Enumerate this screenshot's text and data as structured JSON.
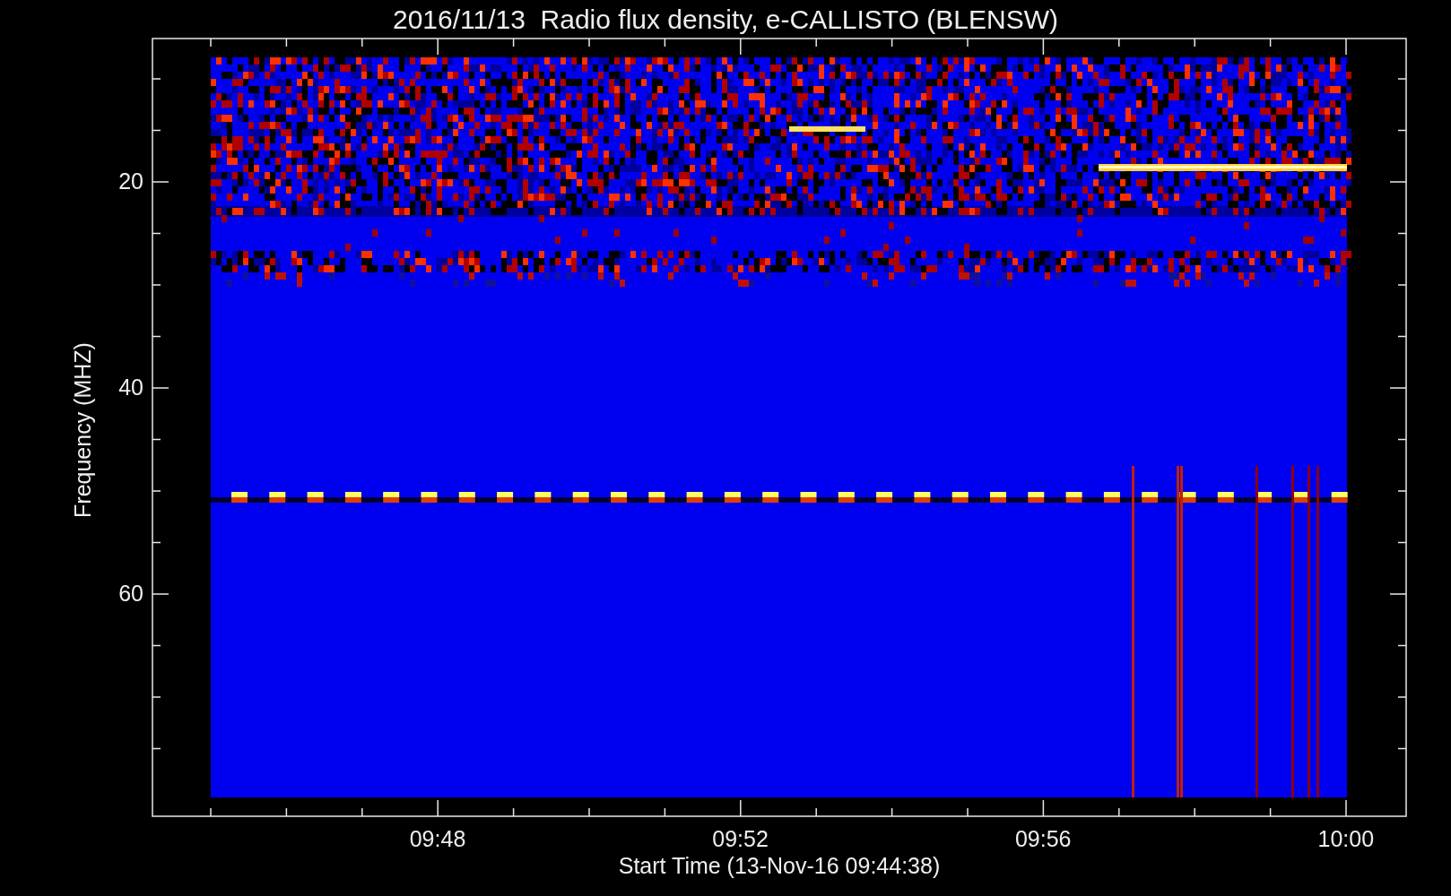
{
  "plot": {
    "title": "2016/11/13  Radio flux density, e-CALLISTO (BLENSW)",
    "ylabel": "Frequency (MHZ)",
    "xlabel": "Start Time (13-Nov-16 09:44:38)",
    "yticks": [
      "20",
      "40",
      "60"
    ],
    "xticks": [
      "09:48",
      "09:52",
      "09:56",
      "10:00"
    ]
  }
}
